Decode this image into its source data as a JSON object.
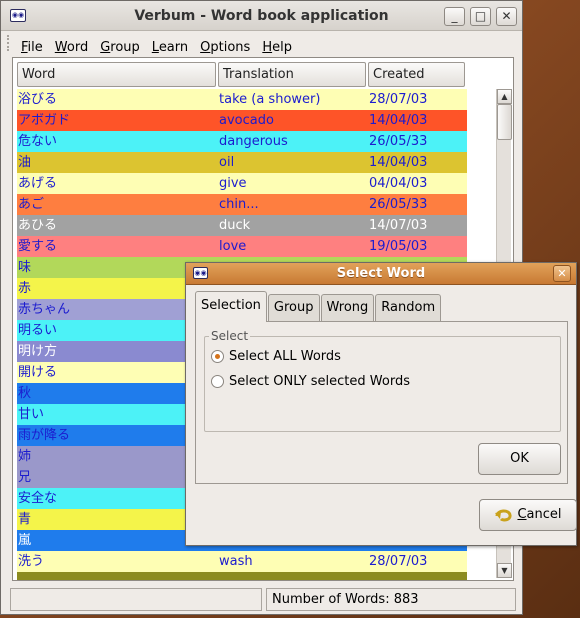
{
  "window": {
    "title": "Verbum - Word book application",
    "controls": {
      "minimize": "_",
      "maximize": "□",
      "close": "✕"
    }
  },
  "menu": {
    "items": [
      {
        "label": "File",
        "mnemonic": "F",
        "rest": "ile"
      },
      {
        "label": "Word",
        "mnemonic": "W",
        "rest": "ord"
      },
      {
        "label": "Group",
        "mnemonic": "G",
        "rest": "roup"
      },
      {
        "label": "Learn",
        "mnemonic": "L",
        "rest": "earn"
      },
      {
        "label": "Options",
        "mnemonic": "O",
        "rest": "ptions"
      },
      {
        "label": "Help",
        "mnemonic": "H",
        "rest": "elp"
      }
    ]
  },
  "table": {
    "columns": [
      "Word",
      "Translation",
      "Created"
    ],
    "rows": [
      {
        "word": "浴びる",
        "translation": "take (a shower)",
        "created": "28/07/03",
        "bg": "#fefeb4",
        "fg": "#1c1ccf"
      },
      {
        "word": "アボガド",
        "translation": "avocado",
        "created": "14/04/03",
        "bg": "#fe5428",
        "fg": "#1c1ccf"
      },
      {
        "word": "危ない",
        "translation": "dangerous",
        "created": "26/05/33",
        "bg": "#4cf2f7",
        "fg": "#1c1ccf"
      },
      {
        "word": "油",
        "translation": "oil",
        "created": "14/04/03",
        "bg": "#dcc430",
        "fg": "#1c1ccf"
      },
      {
        "word": "あげる",
        "translation": "give",
        "created": "04/04/03",
        "bg": "#fefeb4",
        "fg": "#1c1ccf"
      },
      {
        "word": "あご",
        "translation": "chin...",
        "created": "26/05/33",
        "bg": "#fe7e40",
        "fg": "#1c1ccf"
      },
      {
        "word": "あひる",
        "translation": "duck",
        "created": "14/07/03",
        "bg": "#a2a2a2",
        "fg": "#ffffff"
      },
      {
        "word": "愛する",
        "translation": "love",
        "created": "19/05/03",
        "bg": "#fe8080",
        "fg": "#1c1ccf"
      },
      {
        "word": "味",
        "translation": "",
        "created": "",
        "bg": "#b2d85a",
        "fg": "#1c1ccf"
      },
      {
        "word": "赤",
        "translation": "",
        "created": "",
        "bg": "#f4f44a",
        "fg": "#1c1ccf"
      },
      {
        "word": "赤ちゃん",
        "translation": "",
        "created": "",
        "bg": "#a0a0d4",
        "fg": "#1c1ccf"
      },
      {
        "word": "明るい",
        "translation": "",
        "created": "",
        "bg": "#4cf2f7",
        "fg": "#1c1ccf"
      },
      {
        "word": "明け方",
        "translation": "",
        "created": "",
        "bg": "#8a8ad0",
        "fg": "#ffffff"
      },
      {
        "word": "開ける",
        "translation": "",
        "created": "",
        "bg": "#fefeb4",
        "fg": "#1c1ccf"
      },
      {
        "word": "秋",
        "translation": "",
        "created": "",
        "bg": "#1f7cec",
        "fg": "#1c1ccf"
      },
      {
        "word": "甘い",
        "translation": "",
        "created": "",
        "bg": "#4cf2f7",
        "fg": "#1c1ccf"
      },
      {
        "word": "雨が降る",
        "translation": "",
        "created": "",
        "bg": "#1f7cec",
        "fg": "#1c1ccf"
      },
      {
        "word": "姉",
        "translation": "",
        "created": "",
        "bg": "#9a98ca",
        "fg": "#1c1ccf"
      },
      {
        "word": "兄",
        "translation": "",
        "created": "",
        "bg": "#9a98ca",
        "fg": "#1c1ccf"
      },
      {
        "word": "安全な",
        "translation": "",
        "created": "",
        "bg": "#4cf2f7",
        "fg": "#1c1ccf"
      },
      {
        "word": "青",
        "translation": "",
        "created": "",
        "bg": "#f4f44a",
        "fg": "#1c1ccf"
      },
      {
        "word": "嵐",
        "translation": "",
        "created": "",
        "bg": "#1f7cec",
        "fg": "#ffffff"
      },
      {
        "word": "洗う",
        "translation": "wash",
        "created": "28/07/03",
        "bg": "#fefeb4",
        "fg": "#1c1ccf"
      },
      {
        "word": "",
        "translation": "",
        "created": "",
        "bg": "#8c8c20",
        "fg": "#1c1ccf"
      }
    ]
  },
  "status": {
    "left": "",
    "word_count": "Number of Words: 883"
  },
  "dialog": {
    "title": "Select Word",
    "tabs": [
      "Selection",
      "Group",
      "Wrong",
      "Random"
    ],
    "active_tab": "Selection",
    "group_label": "Select",
    "options": [
      {
        "label": "Select ALL Words",
        "selected": true
      },
      {
        "label": "Select ONLY selected Words",
        "selected": false
      }
    ],
    "ok_label": "OK",
    "cancel_label": "Cancel",
    "cancel_mnemonic": "C",
    "cancel_rest": "ancel"
  }
}
